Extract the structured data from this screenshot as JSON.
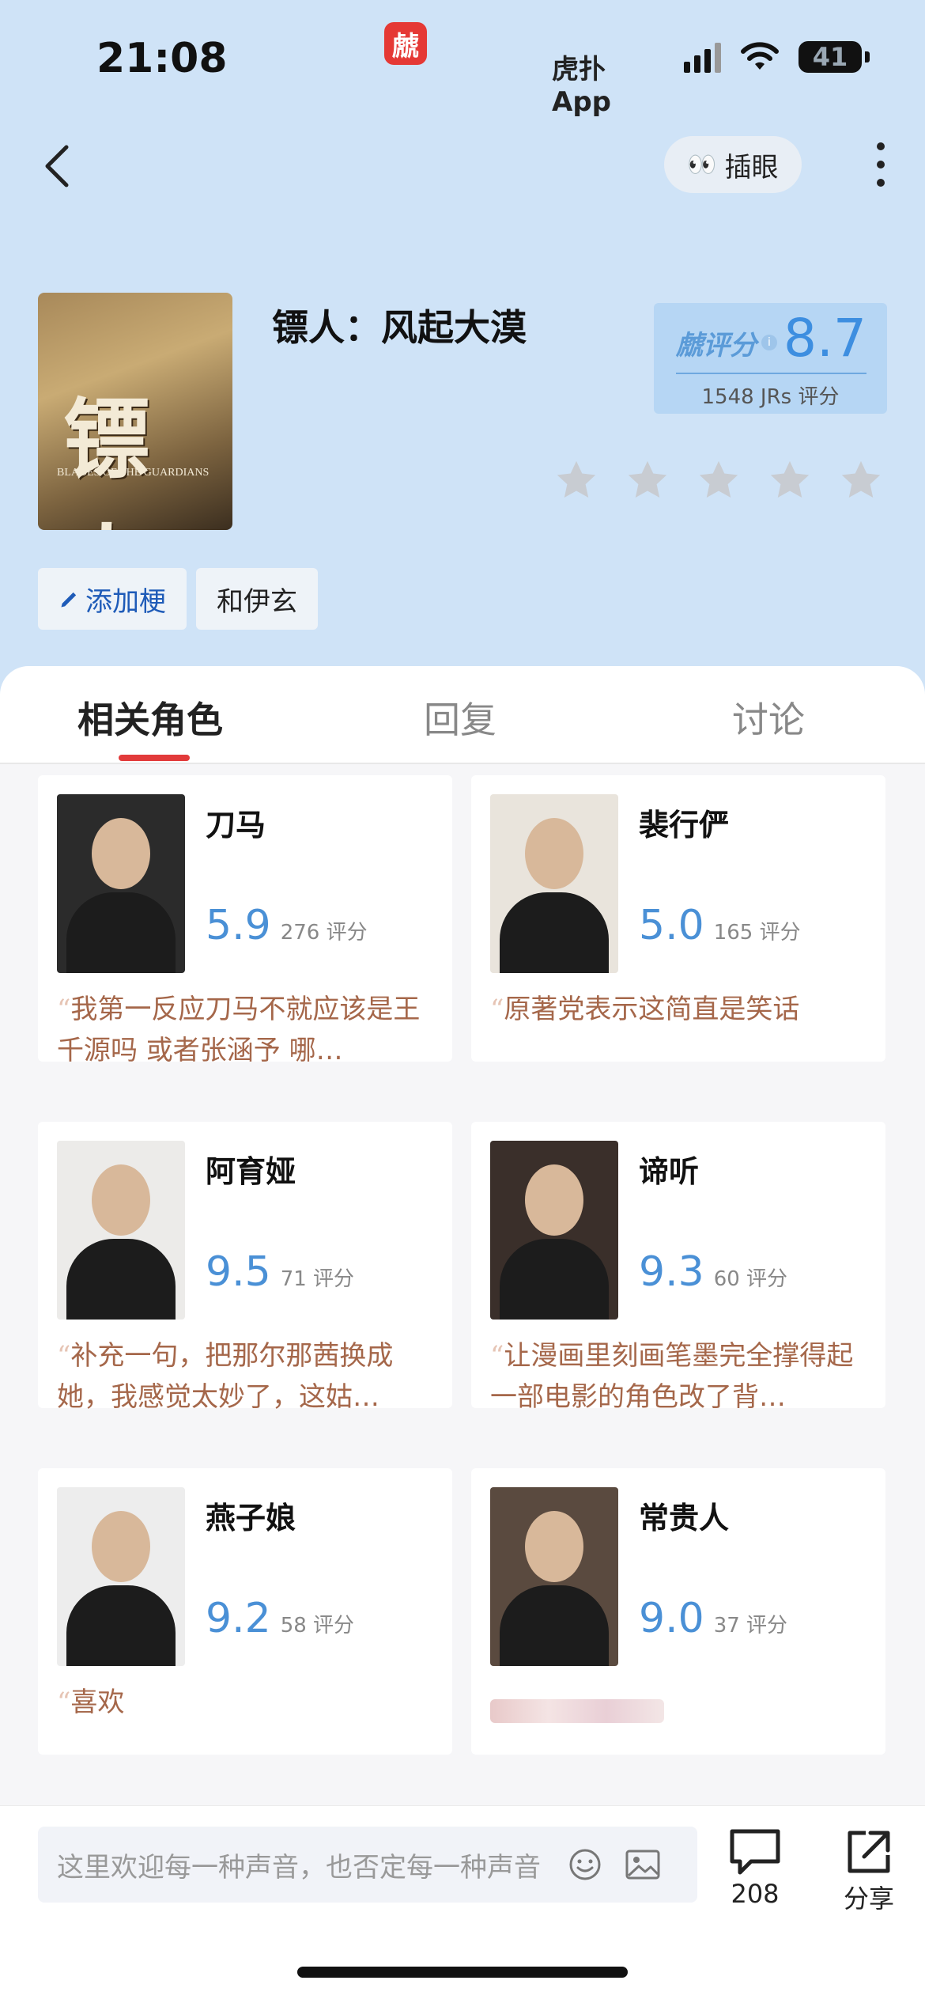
{
  "status_bar": {
    "time": "21:08",
    "app_name": "虎扑App",
    "app_logo_glyph": "虤",
    "battery": "41"
  },
  "nav": {
    "peek_label": "插眼",
    "peek_emoji": "👀"
  },
  "show": {
    "title": "镖人：风起大漠",
    "poster_glyph": "镖人",
    "poster_subtitle": "BLADES OF THE GUARDIANS",
    "score_brand": "虤评分",
    "score": "8.7",
    "score_count": "1548 JRs 评分",
    "user_stars": 0
  },
  "tags": [
    {
      "label": "添加梗"
    },
    {
      "label": "和伊玄"
    }
  ],
  "tabs": [
    {
      "label": "相关角色",
      "active": true
    },
    {
      "label": "回复",
      "active": false
    },
    {
      "label": "讨论",
      "active": false
    }
  ],
  "characters": [
    {
      "name": "刀马",
      "score": "5.9",
      "count": "276 评分",
      "quote": "我第一反应刀马不就应该是王千源吗 或者张涵予 哪…",
      "photo_bg": "#2b2b2b"
    },
    {
      "name": "裴行俨",
      "score": "5.0",
      "count": "165 评分",
      "quote": "原著党表示这简直是笑话",
      "photo_bg": "#e9e4dc"
    },
    {
      "name": "阿育娅",
      "score": "9.5",
      "count": "71 评分",
      "quote": "补充一句，把那尔那茜换成她，我感觉太妙了，这姑…",
      "photo_bg": "#ecebe9"
    },
    {
      "name": "谛听",
      "score": "9.3",
      "count": "60 评分",
      "quote": "让漫画里刻画笔墨完全撑得起一部电影的角色改了背…",
      "photo_bg": "#3a2f2a"
    },
    {
      "name": "燕子娘",
      "score": "9.2",
      "count": "58 评分",
      "quote": "喜欢",
      "photo_bg": "#ededed"
    },
    {
      "name": "常贵人",
      "score": "9.0",
      "count": "37 评分",
      "quote": "",
      "photo_bg": "#5a4a3f"
    }
  ],
  "bottom_bar": {
    "placeholder": "这里欢迎每一种声音，也否定每一种声音",
    "comment_count": "208",
    "share_label": "分享"
  },
  "colors": {
    "accent_blue": "#3d8ee0",
    "tab_indicator": "#e23a3a",
    "quote_text": "#a5674a"
  }
}
